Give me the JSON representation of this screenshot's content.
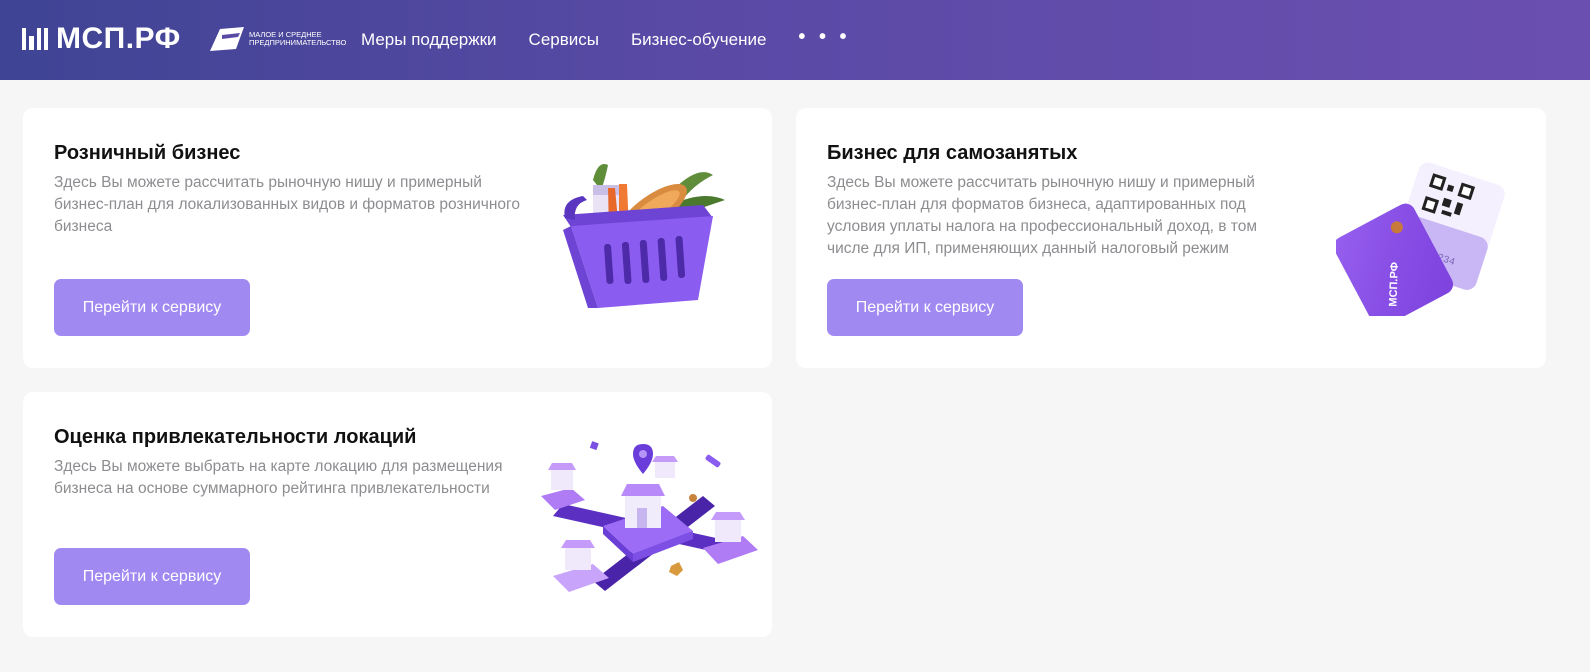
{
  "header": {
    "logo_text": "МСП.РФ",
    "brand_text": "МАЛОЕ И СРЕДНЕЕ ПРЕДПРИНИМАТЕЛЬСТВО",
    "nav": [
      {
        "label": "Меры поддержки"
      },
      {
        "label": "Сервисы"
      },
      {
        "label": "Бизнес-обучение"
      },
      {
        "label": "• • •"
      }
    ]
  },
  "cards": [
    {
      "title": "Розничный бизнес",
      "description": "Здесь Вы можете рассчитать рыночную нишу и примерный бизнес-план для локализованных видов и форматов розничного бизнеса",
      "button_label": "Перейти к сервису",
      "illustration": "shopping-basket-icon"
    },
    {
      "title": "Бизнес для самозанятых",
      "description": "Здесь Вы можете рассчитать рыночную нишу и примерный бизнес-план для форматов бизнеса, адаптированных под условия уплаты налога на профессиональный доход, в том числе для ИП, применяющих данный налоговый режим",
      "button_label": "Перейти к сервису",
      "illustration": "payment-cards-qr-icon",
      "card_brand_text": "МСП.РФ",
      "card_number_text": "1234"
    },
    {
      "title": "Оценка привлекательности локаций",
      "description": "Здесь Вы можете выбрать на карте локацию для размещения бизнеса на основе суммарного рейтинга привлекательности",
      "button_label": "Перейти к сервису",
      "illustration": "location-network-icon"
    }
  ],
  "colors": {
    "header_start": "#3f4494",
    "header_end": "#6b4fb0",
    "button": "#a08af2",
    "background": "#f6f6f7",
    "accent_purple": "#7b4fe0"
  }
}
